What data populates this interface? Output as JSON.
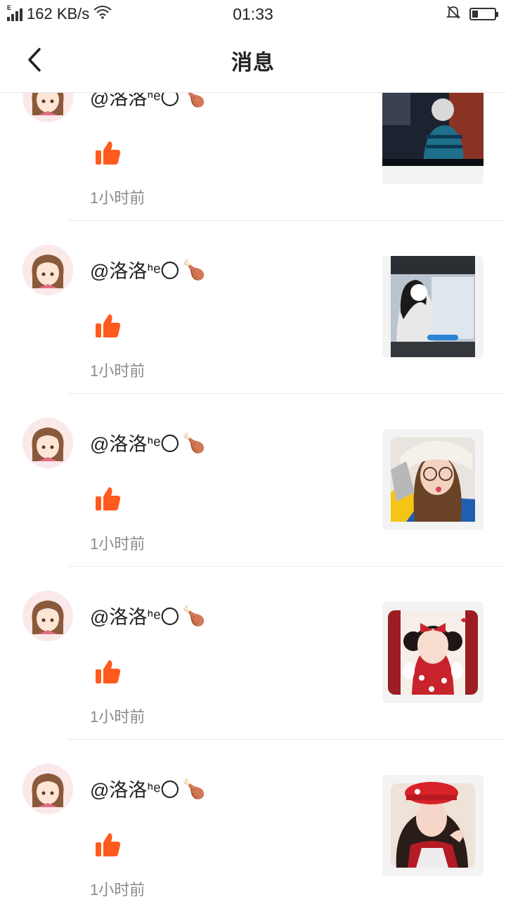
{
  "status_bar": {
    "network_type": "E",
    "speed": "162 KB/s",
    "time": "01:33",
    "icons": [
      "signal-icon",
      "wifi-icon",
      "mute-icon",
      "battery-icon"
    ]
  },
  "header": {
    "title": "消息",
    "back_icon": "chevron-left-icon"
  },
  "colors": {
    "like": "#ff5a1e",
    "time_text": "#8a8a8a",
    "divider": "#ececec"
  },
  "notifications": [
    {
      "username": "@洛洛ᑋᵉ〇",
      "emoji": "🍗",
      "action_icon": "thumbs-up-icon",
      "time": "1小时前",
      "thumb": "photo-elder-man-blue-sweater"
    },
    {
      "username": "@洛洛ᑋᵉ〇",
      "emoji": "🍗",
      "action_icon": "thumbs-up-icon",
      "time": "1小时前",
      "thumb": "screenshot-girl-photo"
    },
    {
      "username": "@洛洛ᑋᵉ〇",
      "emoji": "🍗",
      "action_icon": "thumbs-up-icon",
      "time": "1小时前",
      "thumb": "photo-girl-white-hat"
    },
    {
      "username": "@洛洛ᑋᵉ〇",
      "emoji": "🍗",
      "action_icon": "thumbs-up-icon",
      "time": "1小时前",
      "thumb": "photo-girl-red-bow"
    },
    {
      "username": "@洛洛ᑋᵉ〇",
      "emoji": "🍗",
      "action_icon": "thumbs-up-icon",
      "time": "1小时前",
      "thumb": "photo-girl-red-beret"
    }
  ]
}
